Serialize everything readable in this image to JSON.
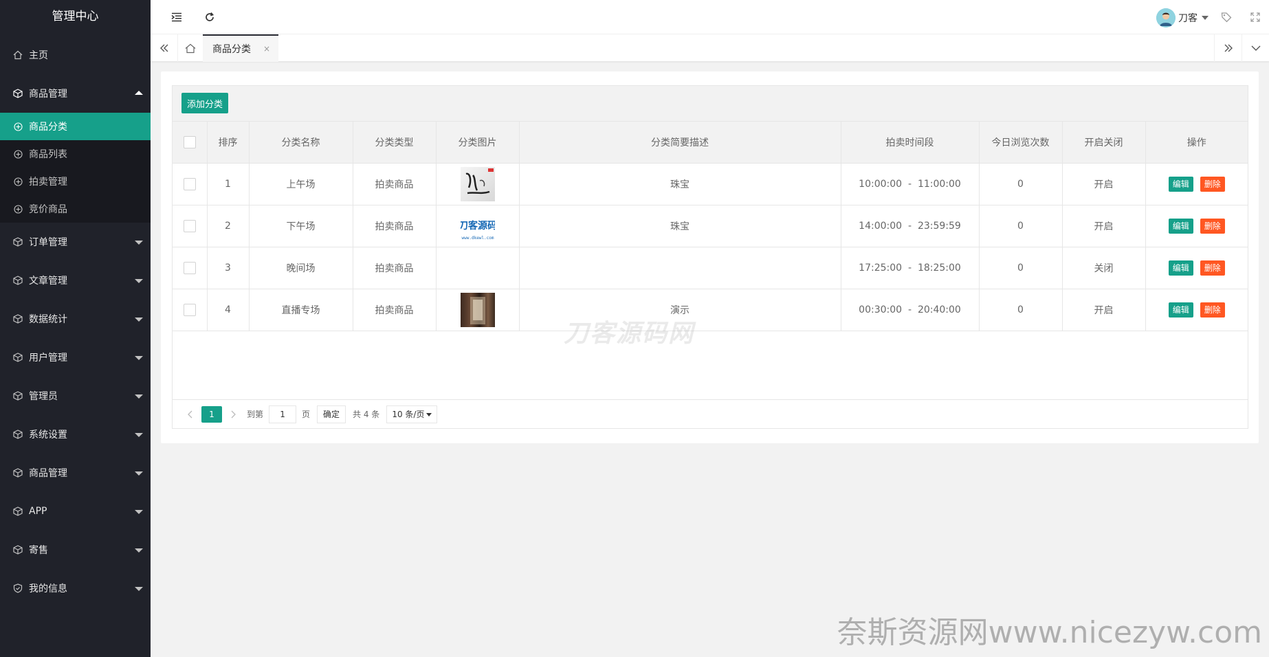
{
  "sidebar": {
    "title": "管理中心",
    "home": "主页",
    "product_mgmt": "商品管理",
    "sub_items": [
      "商品分类",
      "商品列表",
      "拍卖管理",
      "竞价商品"
    ],
    "groups": [
      "订单管理",
      "文章管理",
      "数据统计",
      "用户管理",
      "管理员",
      "系统设置",
      "商品管理",
      "APP",
      "寄售",
      "我的信息"
    ]
  },
  "header": {
    "user_name": "刀客"
  },
  "tabs": {
    "active_tab": "商品分类",
    "close": "×"
  },
  "toolbar": {
    "add_label": "添加分类"
  },
  "table": {
    "headers": [
      "排序",
      "分类名称",
      "分类类型",
      "分类图片",
      "分类简要描述",
      "拍卖时间段",
      "今日浏览次数",
      "开启关闭",
      "操作"
    ],
    "edit_label": "编辑",
    "delete_label": "删除",
    "time_sep": "-",
    "rows": [
      {
        "order": "1",
        "name": "上午场",
        "type": "拍卖商品",
        "image": "thumb1",
        "desc": "珠宝",
        "start": "10:00:00",
        "end": "11:00:00",
        "views": "0",
        "status": "开启"
      },
      {
        "order": "2",
        "name": "下午场",
        "type": "拍卖商品",
        "image": "thumb2",
        "desc": "珠宝",
        "start": "14:00:00",
        "end": "23:59:59",
        "views": "0",
        "status": "开启"
      },
      {
        "order": "3",
        "name": "晚间场",
        "type": "拍卖商品",
        "image": "",
        "desc": "",
        "start": "17:25:00",
        "end": "18:25:00",
        "views": "0",
        "status": "关闭"
      },
      {
        "order": "4",
        "name": "直播专场",
        "type": "拍卖商品",
        "image": "thumb4",
        "desc": "演示",
        "start": "00:30:00",
        "end": "20:40:00",
        "views": "0",
        "status": "开启"
      }
    ]
  },
  "pager": {
    "current": "1",
    "goto_label": "到第",
    "goto_value": "1",
    "page_unit": "页",
    "ok_label": "确定",
    "total": "共 4 条",
    "page_size": "10 条/页"
  },
  "thumbs": {
    "thumb1_text": "书法",
    "thumb2_text": "刀客源码",
    "thumb2_url": "www.dkewl.com"
  },
  "watermarks": {
    "center": "刀客源码网",
    "corner": "奈斯资源网www.nicezyw.com"
  },
  "colors": {
    "accent": "#16a08a",
    "danger": "#ff5722",
    "sidebar_bg": "#20222a"
  }
}
